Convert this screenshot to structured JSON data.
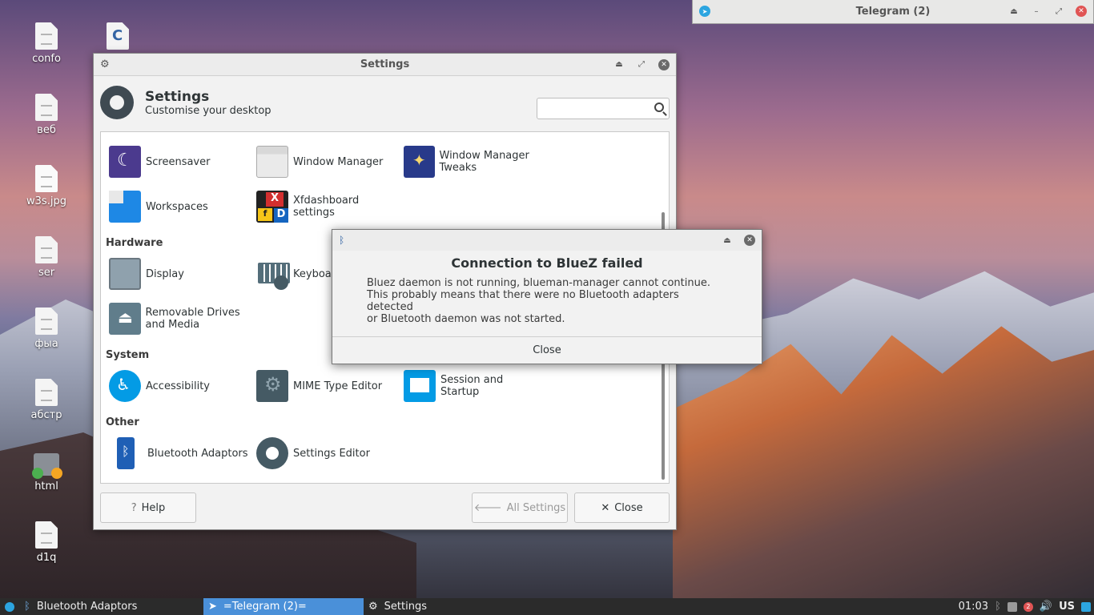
{
  "desktop": {
    "icons": [
      {
        "label": "confo",
        "type": "file"
      },
      {
        "label": "",
        "type": "c-file",
        "glyph": "C"
      },
      {
        "label": "веб",
        "type": "file"
      },
      {
        "label": "w3s.jpg",
        "type": "image"
      },
      {
        "label": "ser",
        "type": "file"
      },
      {
        "label": "фыа",
        "type": "file"
      },
      {
        "label": "абстр",
        "type": "file"
      },
      {
        "label": "html",
        "type": "folder"
      },
      {
        "label": "d1q",
        "type": "file"
      }
    ]
  },
  "telegram_window": {
    "title": "Telegram (2)",
    "buttons": [
      "eject-icon",
      "minimize-icon",
      "maximize-icon",
      "close-icon"
    ]
  },
  "settings_window": {
    "title": "Settings",
    "header_title": "Settings",
    "header_subtitle": "Customise your desktop",
    "search_placeholder": "",
    "sections": {
      "hardware": "Hardware",
      "system": "System",
      "other": "Other"
    },
    "items": {
      "screensaver": "Screensaver",
      "window_manager": "Window Manager",
      "window_manager_tweaks": "Window Manager Tweaks",
      "workspaces": "Workspaces",
      "xfdashboard": "Xfdashboard settings",
      "display": "Display",
      "keyboard": "Keyboa",
      "removable": "Removable Drives and Media",
      "accessibility": "Accessibility",
      "mime": "MIME Type Editor",
      "session": "Session and Startup",
      "bluetooth": "Bluetooth Adaptors",
      "settings_editor": "Settings Editor"
    },
    "footer": {
      "help": "Help",
      "all_settings": "All Settings",
      "close": "Close"
    }
  },
  "bluez_dialog": {
    "title": "Connection to BlueZ failed",
    "message": "Bluez daemon is not running, blueman-manager cannot continue.\nThis probably means that there were no Bluetooth adapters detected\nor Bluetooth daemon was not started.",
    "close": "Close"
  },
  "taskbar": {
    "tasks": [
      "Bluetooth Adaptors",
      "=Telegram (2)=",
      "Settings"
    ],
    "clock": "01:03",
    "notif_count": "2",
    "keyboard_layout": "US"
  },
  "colors": {
    "accent": "#4a90d9",
    "telegram": "#2ca5e0",
    "close_red": "#e05454"
  }
}
